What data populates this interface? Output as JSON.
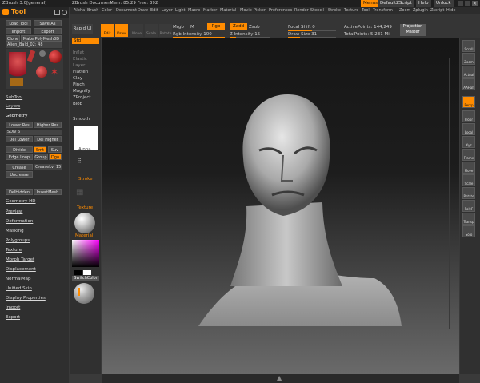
{
  "titlebar": {
    "app": "ZBrush 3.0[general]",
    "doc": "ZBrush Document",
    "mem": "Mem: 85.29  Free: 392",
    "buttons": [
      "Menus",
      "DefaultZScript",
      "Help",
      "Unlock"
    ]
  },
  "menubar": [
    "Alpha",
    "Brush",
    "Color",
    "Document",
    "Draw",
    "Edit",
    "Layer",
    "Light",
    "Macro",
    "Marker",
    "Material",
    "Movie",
    "Picker",
    "Preferences",
    "Render",
    "Stencil",
    "Stroke",
    "Texture",
    "Tool",
    "Transform",
    "Zoom",
    "Zplugin",
    "Zscript",
    "Hide"
  ],
  "tool_palette": {
    "title": "Tool",
    "row1": [
      "Load Tool",
      "Save As"
    ],
    "row2": [
      "Import",
      "Export"
    ],
    "row3": [
      "Clone",
      "Make PolyMesh3D"
    ],
    "current_tool": "Alien_Bald_02: 48",
    "subtool": "SubTool",
    "layers": "Layers",
    "geometry": "Geometry",
    "lower_res": "Lower Res",
    "higher_res": "Higher Res",
    "sdiv": "SDiv 6",
    "del_lower": "Del Lower",
    "del_higher": "Del Higher",
    "divide": "Divide",
    "smt": "Smt",
    "suv": "Suv",
    "edge_loop": "Edge Loop",
    "group": "Group",
    "dgo": "Dgo",
    "crease": "Crease",
    "crease_lvl": "CreaseLvl 15",
    "uncrease": "Uncrease",
    "del_hidden": "DelHidden",
    "insert_mesh": "InsertMesh",
    "sections": [
      "Geometry HD",
      "Preview",
      "Deformation",
      "Masking",
      "Polygroups",
      "Texture",
      "Morph Target",
      "Displacement",
      "NormalMap",
      "Unified Skin",
      "Display Properties",
      "Import",
      "Export"
    ]
  },
  "shelf": {
    "rapid_ui": "Rapid UI",
    "edit": "Edit",
    "draw": "Draw",
    "move": "Move",
    "scale": "Scale",
    "rotate": "Rotate",
    "mrgb": "Mrgb",
    "rgb": "Rgb",
    "m": "M",
    "rgb_intensity": "Rgb Intensity 100",
    "zadd": "Zadd",
    "zsub": "Zsub",
    "z_intensity": "Z Intensity 15",
    "focal_shift": "Focal Shift 0",
    "draw_size": "Draw Size 31",
    "active_points": "ActivePoints: 144,249",
    "total_points": "TotalPoints: 5.231 Mil",
    "projection_master": "Projection Master"
  },
  "left_shelf": [
    "Std",
    "Inflat",
    "Elastic",
    "Layer",
    "Flatten",
    "Clay",
    "Pinch",
    "Magnify",
    "ZProject",
    "Blob",
    "Smooth",
    "Alpha",
    "Stroke",
    "Texture",
    "Material",
    "SwitchColor"
  ],
  "right_shelf": [
    "Scroll",
    "Zoom",
    "Actual",
    "AAHalf",
    "Persp",
    "Floor",
    "Local",
    "Xyz",
    "Frame",
    "Move",
    "Scale",
    "Rotate",
    "PolyF",
    "Transp",
    "Solo"
  ],
  "colors": {
    "accent": "#ff8c00",
    "panel": "#2f2f2f",
    "button": "#4b4b4b"
  }
}
